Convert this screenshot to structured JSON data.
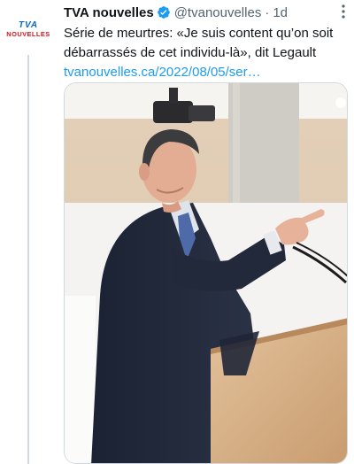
{
  "account": {
    "logo_top": "TVA",
    "logo_bottom": "NOUVELLES",
    "name": "TVA nouvelles",
    "handle": "@tvanouvelles",
    "separator": "·",
    "time": "1d"
  },
  "tweet": {
    "text": "Série de meurtres: «Je suis content qu’on soit débarrassés de cet individu-là», dit Legault",
    "link": "tvanouvelles.ca/2022/08/05/ser…"
  },
  "colors": {
    "verified": "#1d9bf0",
    "link": "#1d9bf0",
    "secondary_text": "#536471",
    "logo_blue": "#0b66c3",
    "logo_red": "#d71920"
  },
  "icons": {
    "verified": "verified-badge-icon",
    "more": "more-options-icon"
  }
}
